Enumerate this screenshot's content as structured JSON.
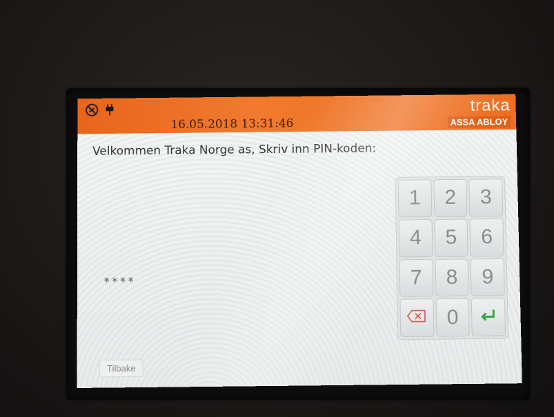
{
  "header": {
    "datetime": "16.05.2018 13:31:46",
    "brand_logo": "traka",
    "brand_sub": "ASSA ABLOY",
    "status_icons": [
      "network-disabled-icon",
      "power-plug-icon"
    ]
  },
  "main": {
    "welcome_text": "Velkommen Traka Norge as, Skriv inn PIN-koden:",
    "pin_masked": "****"
  },
  "keypad": {
    "keys": [
      "1",
      "2",
      "3",
      "4",
      "5",
      "6",
      "7",
      "8",
      "9",
      "0"
    ],
    "backspace_icon": "backspace-icon",
    "enter_icon": "enter-icon"
  },
  "footer": {
    "back_label": "Tilbake"
  },
  "colors": {
    "header_orange": "#ee6f22",
    "enter_green": "#3aa64a",
    "backspace_red": "#d9534f"
  }
}
